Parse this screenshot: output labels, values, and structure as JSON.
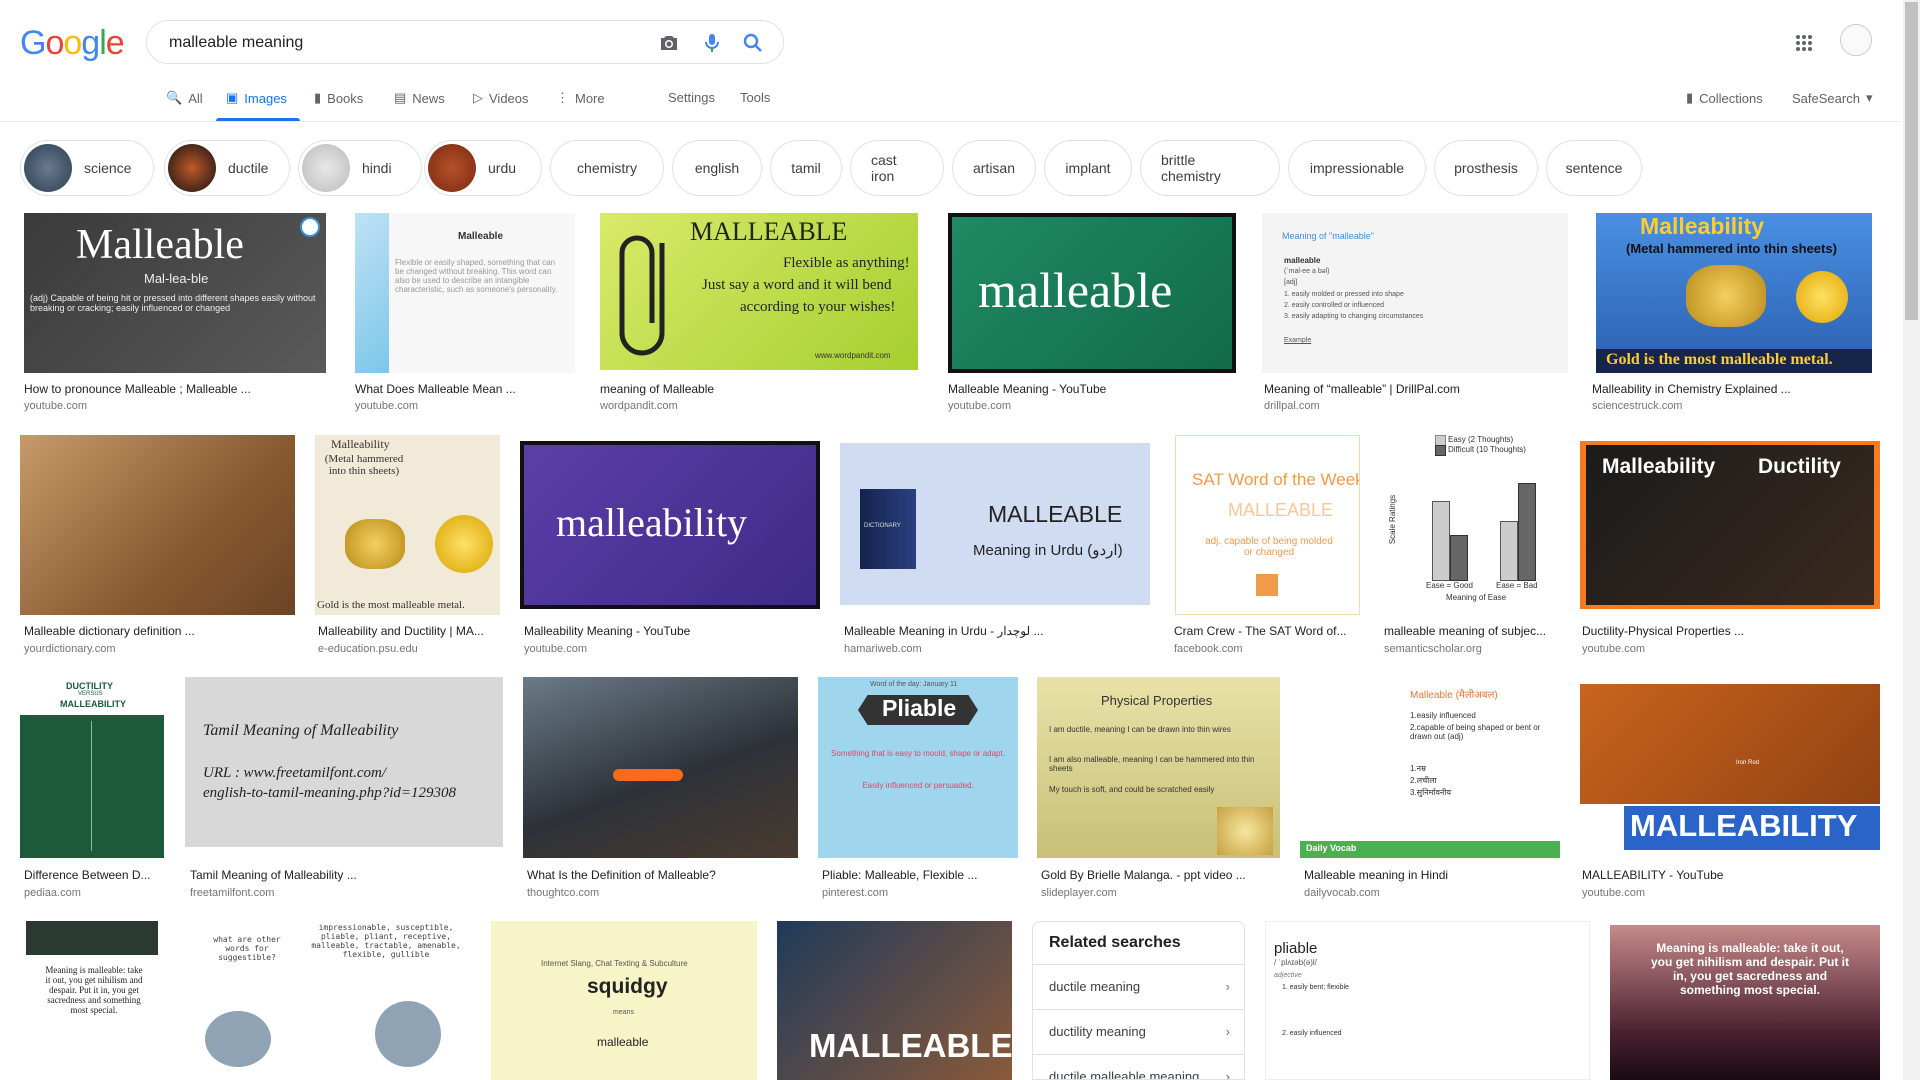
{
  "logo_letters": [
    "G",
    "o",
    "o",
    "g",
    "l",
    "e"
  ],
  "search": {
    "value": "malleable meaning"
  },
  "tabs": {
    "all": "All",
    "images": "Images",
    "books": "Books",
    "news": "News",
    "videos": "Videos",
    "more": "More",
    "settings": "Settings",
    "tools": "Tools",
    "collections": "Collections",
    "safesearch": "SafeSearch"
  },
  "chips": [
    "science",
    "ductile",
    "hindi",
    "urdu",
    "chemistry",
    "english",
    "tamil",
    "cast iron",
    "artisan",
    "implant",
    "brittle chemistry",
    "impressionable",
    "prosthesis",
    "sentence"
  ],
  "images": [
    {
      "caption": "How to pronounce Malleable ; Malleable ...",
      "source": "youtube.com",
      "text": [
        "Malleable",
        "Mal-lea-ble",
        "(adj) Capable of being hit or pressed into different shapes easily without breaking or cracking; easily influenced or changed"
      ]
    },
    {
      "caption": "What Does Malleable Mean ...",
      "source": "youtube.com",
      "text": [
        "Malleable",
        "Flexible or easily shaped, something that can be changed without breaking. This word can also be used to describe an intangible characteristic, such as someone's personality."
      ]
    },
    {
      "caption": "meaning of Malleable",
      "source": "wordpandit.com",
      "text": [
        "MALLEABLE",
        "Flexible as anything!",
        "Just say a word and it will bend",
        "according to your wishes!",
        "www.wordpandit.com"
      ]
    },
    {
      "caption": "Malleable Meaning - YouTube",
      "source": "youtube.com",
      "text": [
        "malleable"
      ]
    },
    {
      "caption": "Meaning of “malleable” | DrillPal.com",
      "source": "drillpal.com",
      "text": [
        "Meaning of \"malleable\"",
        "malleable",
        "(ˈmal-ee a bəl)",
        "[adj]",
        "1. easily molded or pressed into shape",
        "2. easily controlled or influenced",
        "3. easily adapting to changing circumstances",
        "Example"
      ]
    },
    {
      "caption": "Malleability in Chemistry Explained ...",
      "source": "sciencestruck.com",
      "text": [
        "Malleability",
        "(Metal hammered into thin sheets)",
        "Gold is the most malleable metal."
      ]
    },
    {
      "caption": "Malleable dictionary definition ...",
      "source": "yourdictionary.com",
      "text": []
    },
    {
      "caption": "Malleability and Ductility | MA...",
      "source": "e-education.psu.edu",
      "text": [
        "Malleability",
        "(Metal hammered into thin sheets)",
        "Gold is the most malleable metal."
      ]
    },
    {
      "caption": "Malleability Meaning - YouTube",
      "source": "youtube.com",
      "text": [
        "malleability"
      ]
    },
    {
      "caption": "Malleable Meaning in Urdu - لوچدار ...",
      "source": "hamariweb.com",
      "text": [
        "MALLEABLE",
        "Meaning in Urdu (اردو)",
        "DICTIONARY"
      ]
    },
    {
      "caption": "Cram Crew - The SAT Word of...",
      "source": "facebook.com",
      "text": [
        "SAT Word of the Week",
        "MALLEABLE",
        "adj. capable of being molded or changed"
      ]
    },
    {
      "caption": "malleable meaning of subjec...",
      "source": "semanticscholar.org",
      "text": [
        "Easy (2 Thoughts)",
        "Difficult (10 Thoughts)",
        "Scale Ratings",
        "Ease = Good",
        "Ease = Bad",
        "Meaning of Ease"
      ]
    },
    {
      "caption": "Ductility-Physical Properties ...",
      "source": "youtube.com",
      "text": [
        "Malleability",
        "Ductility"
      ]
    },
    {
      "caption": "Difference Between D...",
      "source": "pediaa.com",
      "text": [
        "DUCTILITY",
        "VERSUS",
        "MALLEABILITY"
      ]
    },
    {
      "caption": "Tamil Meaning of Malleability ...",
      "source": "freetamilfont.com",
      "text": [
        "Tamil Meaning of Malleability",
        "URL : www.freetamilfont.com/",
        "english-to-tamil-meaning.php?id=129308"
      ]
    },
    {
      "caption": "What Is the Definition of Malleable?",
      "source": "thoughtco.com",
      "text": []
    },
    {
      "caption": "Pliable: Malleable, Flexible ...",
      "source": "pinterest.com",
      "text": [
        "Word of the day: January 11",
        "Pliable",
        "Something that is easy to mould, shape or adapt.",
        "Easily influenced or persuaded."
      ]
    },
    {
      "caption": "Gold By Brielle Malanga. - ppt video ...",
      "source": "slideplayer.com",
      "text": [
        "Physical Properties",
        "I am ductile, meaning I can be drawn into thin wires",
        "I am also malleable, meaning I can be hammered into thin sheets",
        "My touch is soft, and could be scratched easily"
      ]
    },
    {
      "caption": "Malleable meaning in Hindi",
      "source": "dailyvocab.com",
      "text": [
        "Malleable (मैलीअबल)",
        "1.easily influenced",
        "2.capable of being shaped or bent or drawn out (adj)",
        "1.नम्र",
        "2.लचीला",
        "3.सुनिर्मावनीय",
        "Daily Vocab"
      ]
    },
    {
      "caption": "MALLEABILITY - YouTube",
      "source": "youtube.com",
      "text": [
        "MALLEABILITY",
        "Iron Rod"
      ]
    },
    {
      "caption": "",
      "source": "",
      "text": [
        "Meaning is malleable: take it out, you get nihilism and despair. Put it in, you get sacredness and something most special."
      ]
    },
    {
      "caption": "",
      "source": "",
      "text": [
        "what are other words for suggestible?",
        "impressionable, susceptible, pliable, pliant, receptive, malleable, tractable, amenable, flexible, gullible"
      ]
    },
    {
      "caption": "",
      "source": "",
      "text": [
        "Internet Slang, Chat Texting & Subculture",
        "squidgy",
        "means",
        "malleable"
      ]
    },
    {
      "caption": "",
      "source": "",
      "text": [
        "MALLEABLE"
      ]
    },
    {
      "caption": "",
      "source": "",
      "text": [
        "pliable",
        "/ ˈplʌɪəb(ə)l/",
        "adjective",
        "1. easily bent; flexible",
        "2. easily influenced"
      ]
    },
    {
      "caption": "",
      "source": "",
      "text": [
        "Meaning is malleable: take it out, you get nihilism and despair. Put it in, you get sacredness and something most special."
      ]
    }
  ],
  "related": {
    "title": "Related searches",
    "items": [
      "ductile meaning",
      "ductility meaning",
      "ductile malleable meaning"
    ]
  },
  "colors": {
    "accent": "#1a73e8",
    "text": "#202124",
    "muted": "#70757a"
  }
}
